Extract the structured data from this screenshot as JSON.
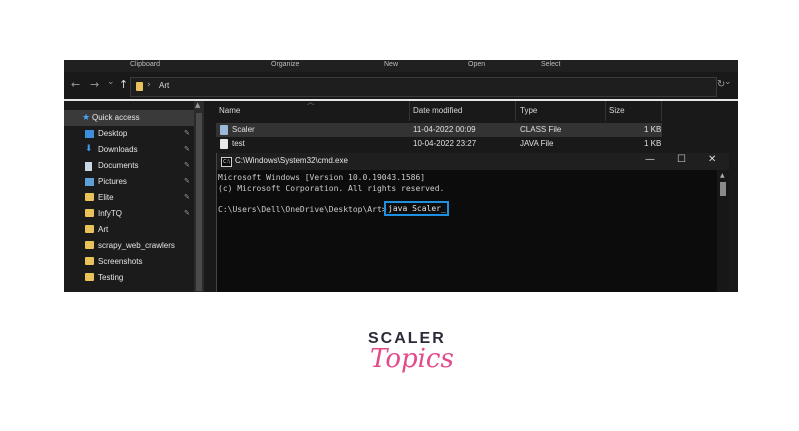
{
  "ribbon": {
    "clipboard": "Clipboard",
    "organize": "Organize",
    "new": "New",
    "open": "Open",
    "select": "Select"
  },
  "address": {
    "back": "←",
    "forward": "→",
    "recent": "⌄",
    "up": "↑",
    "sep": "›",
    "path": "Art",
    "dropdown": "⌄",
    "refresh": "↻"
  },
  "sidebar": {
    "items": [
      {
        "label": "Quick access",
        "icon": "star-icon"
      },
      {
        "label": "Desktop",
        "icon": "desktop-icon",
        "pin": "📌"
      },
      {
        "label": "Downloads",
        "icon": "download-icon",
        "pin": "📌"
      },
      {
        "label": "Documents",
        "icon": "document-icon",
        "pin": "📌"
      },
      {
        "label": "Pictures",
        "icon": "pictures-icon",
        "pin": "📌"
      },
      {
        "label": "Elite",
        "icon": "folder-icon",
        "pin": "📌"
      },
      {
        "label": "InfyTQ",
        "icon": "folder-icon",
        "pin": "📌"
      },
      {
        "label": "Art",
        "icon": "folder-icon"
      },
      {
        "label": "scrapy_web_crawlers",
        "icon": "folder-icon"
      },
      {
        "label": "Screenshots",
        "icon": "folder-icon"
      },
      {
        "label": "Testing",
        "icon": "folder-icon"
      }
    ]
  },
  "files": {
    "columns": {
      "name": "Name",
      "date": "Date modified",
      "type": "Type",
      "size": "Size"
    },
    "rows": [
      {
        "name": "Scaler",
        "date": "11-04-2022 00:09",
        "type": "CLASS File",
        "size": "1 KB"
      },
      {
        "name": "test",
        "date": "10-04-2022 23:27",
        "type": "JAVA File",
        "size": "1 KB"
      }
    ]
  },
  "cmd": {
    "icon_text": "C:\\",
    "title": "C:\\Windows\\System32\\cmd.exe",
    "minimize": "—",
    "maximize": "☐",
    "close": "✕",
    "lines": [
      "Microsoft Windows [Version 10.0.19043.1586]",
      "(c) Microsoft Corporation. All rights reserved."
    ],
    "prompt": "C:\\Users\\Dell\\OneDrive\\Desktop\\Art>",
    "command": "java Scaler_"
  },
  "logo": {
    "line1": "SCALER",
    "line2": "Topics"
  },
  "colors": {
    "accent": "#1f8fe0",
    "brand": "#e24a8a",
    "folder": "#e9c35a"
  }
}
